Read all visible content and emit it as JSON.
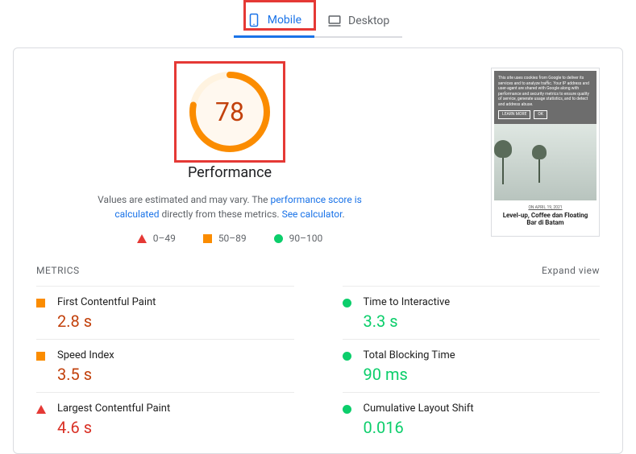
{
  "tabs": {
    "mobile": "Mobile",
    "desktop": "Desktop"
  },
  "score": {
    "value": "78",
    "label": "Performance"
  },
  "desc": {
    "t1": "Values are estimated and may vary. The ",
    "link1": "performance score is calculated",
    "t2": " directly from these metrics. ",
    "link2": "See calculator",
    "t3": "."
  },
  "legend": {
    "poor": "0–49",
    "avg": "50–89",
    "good": "90–100"
  },
  "preview": {
    "banner": "This site uses cookies from Google to deliver its services and to analyze traffic. Your IP address and user-agent are shared with Google along with performance and security metrics to ensure quality of service, generate usage statistics, and to detect and address abuse.",
    "learn": "LEARN MORE",
    "ok": "OK",
    "date": "ON APRIL 19, 2021",
    "title": "Level-up, Coffee dan Floating Bar di Batam"
  },
  "metrics_header": "METRICS",
  "expand": "Expand view",
  "metrics": {
    "fcp": {
      "name": "First Contentful Paint",
      "value": "2.8 s"
    },
    "tti": {
      "name": "Time to Interactive",
      "value": "3.3 s"
    },
    "si": {
      "name": "Speed Index",
      "value": "3.5 s"
    },
    "tbt": {
      "name": "Total Blocking Time",
      "value": "90 ms"
    },
    "lcp": {
      "name": "Largest Contentful Paint",
      "value": "4.6 s"
    },
    "cls": {
      "name": "Cumulative Layout Shift",
      "value": "0.016"
    }
  }
}
